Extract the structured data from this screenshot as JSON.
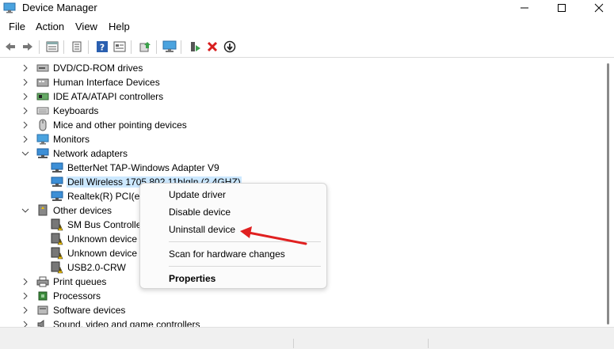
{
  "window": {
    "title": "Device Manager"
  },
  "menu": [
    "File",
    "Action",
    "View",
    "Help"
  ],
  "toolbar": {
    "buttons": [
      "back-icon",
      "forward-icon",
      "properties-icon",
      "help-icon",
      "show-hidden-icon",
      "update-driver-icon",
      "scan-icon",
      "enable-device-icon",
      "uninstall-icon",
      "disable-icon"
    ]
  },
  "tree": {
    "items": [
      {
        "label": "DVD/CD-ROM drives",
        "icon": "dvd-drive-icon",
        "expanded": false
      },
      {
        "label": "Human Interface Devices",
        "icon": "hid-icon",
        "expanded": false
      },
      {
        "label": "IDE ATA/ATAPI controllers",
        "icon": "ide-controller-icon",
        "expanded": false
      },
      {
        "label": "Keyboards",
        "icon": "keyboard-icon",
        "expanded": false
      },
      {
        "label": "Mice and other pointing devices",
        "icon": "mouse-icon",
        "expanded": false
      },
      {
        "label": "Monitors",
        "icon": "monitor-icon",
        "expanded": false
      },
      {
        "label": "Network adapters",
        "icon": "network-adapter-icon",
        "expanded": true
      },
      {
        "label": "BetterNet TAP-Windows Adapter V9",
        "icon": "network-adapter-icon",
        "child": true
      },
      {
        "label": "Dell Wireless 1705 802.11b|g|n (2.4GHZ)",
        "icon": "network-adapter-icon",
        "child": true,
        "selected": true
      },
      {
        "label": "Realtek(R) PCI(e)",
        "icon": "network-adapter-icon",
        "child": true
      },
      {
        "label": "Other devices",
        "icon": "other-devices-icon",
        "expanded": true
      },
      {
        "label": "SM Bus Controlle",
        "icon": "warning-device-icon",
        "child": true
      },
      {
        "label": "Unknown device",
        "icon": "warning-device-icon",
        "child": true
      },
      {
        "label": "Unknown device",
        "icon": "warning-device-icon",
        "child": true
      },
      {
        "label": "USB2.0-CRW",
        "icon": "warning-device-icon",
        "child": true
      },
      {
        "label": "Print queues",
        "icon": "printer-icon",
        "expanded": false
      },
      {
        "label": "Processors",
        "icon": "processor-icon",
        "expanded": false
      },
      {
        "label": "Software devices",
        "icon": "software-device-icon",
        "expanded": false
      },
      {
        "label": "Sound, video and game controllers",
        "icon": "sound-icon",
        "expanded": false
      }
    ]
  },
  "context_menu": {
    "items": [
      "Update driver",
      "Disable device",
      "Uninstall device",
      "Scan for hardware changes",
      "Properties"
    ]
  },
  "colors": {
    "selection": "#cce8ff",
    "arrow": "#e02020",
    "warning": "#f2c200",
    "network": "#1e78c8"
  }
}
